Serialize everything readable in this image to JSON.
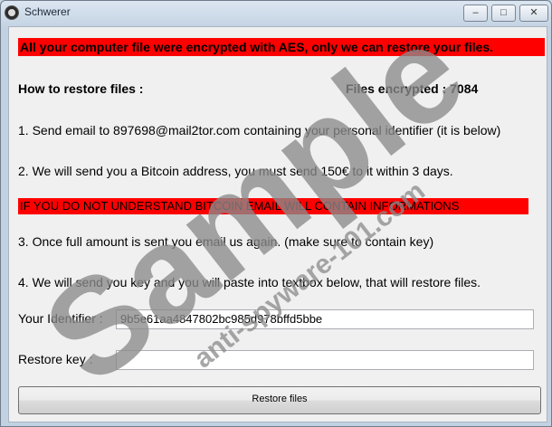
{
  "window": {
    "title": "Schwerer",
    "min_glyph": "–",
    "max_glyph": "□",
    "close_glyph": "✕"
  },
  "content": {
    "banner_top": "All your computer file were encrypted with AES, only we can restore your files.",
    "how_to_title": "How to restore files :",
    "files_encrypted": "Files encrypted : 7084",
    "step1": "1. Send email to 897698@mail2tor.com containing your personal identifier (it is below)",
    "step2": "2. We will send you a Bitcoin address, you must send 150€ to it within 3 days.",
    "banner_mid": "IF YOU DO NOT UNDERSTAND BITCOIN EMAIL WILL CONTAIN INFORMATIONS",
    "step3": "3. Once full amount is sent you email us again. (make sure to contain key)",
    "step4": "4. We will send you key and you will paste into textbox below, that will restore files.",
    "identifier_label": "Your Identifier :",
    "identifier_value": "9b5e61aa4847802bc985d978bffd5bbe",
    "restore_key_label": "Restore key :",
    "restore_key_value": "",
    "restore_button": "Restore files"
  },
  "watermark": {
    "main": "Sample",
    "sub": "anti-spyware-101.com"
  },
  "colors": {
    "banner_bg": "#ff0000",
    "client_bg": "#f0f0f0",
    "watermark": "#8a8a8a"
  }
}
